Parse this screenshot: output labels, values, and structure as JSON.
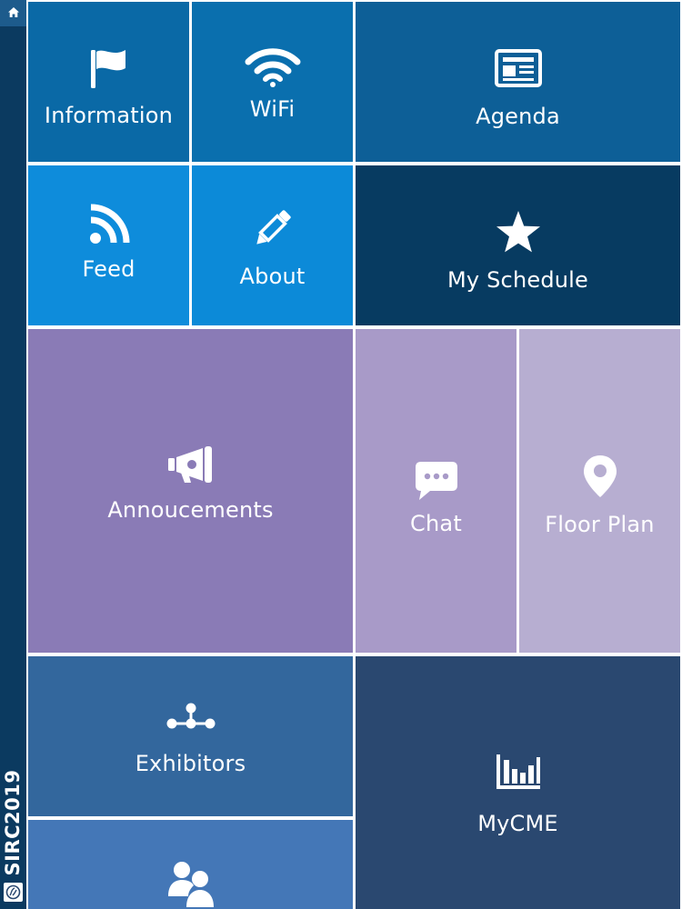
{
  "app": {
    "brand": "SIRC2019"
  },
  "colors": {
    "sidebar": "#0b3a60",
    "home_button": "#1d5b8c",
    "information": "#0a69a6",
    "wifi": "#0a6fae",
    "agenda": "#0d5f97",
    "feed": "#0e8cdb",
    "about": "#0c8ad8",
    "my_schedule": "#073b61",
    "announcements": "#8a7bb6",
    "chat": "#a89ac8",
    "floor_plan": "#b7aed1",
    "exhibitors": "#33679d",
    "mycme": "#2a4870",
    "attendees": "#4477b7"
  },
  "tiles": {
    "information": {
      "label": "Information",
      "icon": "flag-icon"
    },
    "wifi": {
      "label": "WiFi",
      "icon": "wifi-icon"
    },
    "agenda": {
      "label": "Agenda",
      "icon": "newspaper-icon"
    },
    "feed": {
      "label": "Feed",
      "icon": "rss-icon"
    },
    "about": {
      "label": "About",
      "icon": "pencil-icon"
    },
    "my_schedule": {
      "label": "My Schedule",
      "icon": "star-icon"
    },
    "announcements": {
      "label": "Annoucements",
      "icon": "megaphone-icon"
    },
    "chat": {
      "label": "Chat",
      "icon": "chat-bubble-icon"
    },
    "floor_plan": {
      "label": "Floor Plan",
      "icon": "map-pin-icon"
    },
    "exhibitors": {
      "label": "Exhibitors",
      "icon": "network-icon"
    },
    "mycme": {
      "label": "MyCME",
      "icon": "bar-chart-icon"
    },
    "attendees": {
      "icon": "users-icon"
    }
  }
}
